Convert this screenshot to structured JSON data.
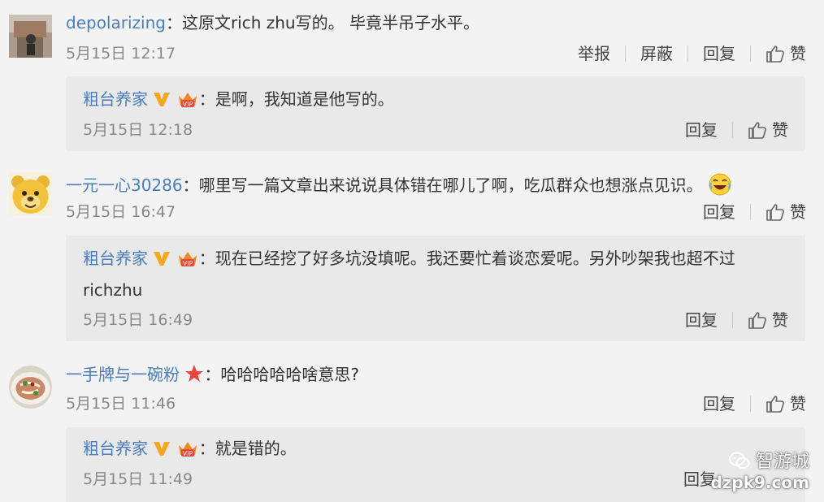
{
  "comments": [
    {
      "user": "depolarizing",
      "text": "：这原文rich zhu写的。 毕竟半吊子水平。",
      "time": "5月15日 12:17",
      "actions": [
        "举报",
        "屏蔽",
        "回复",
        "赞"
      ],
      "reply": {
        "user": "粗台养家",
        "text": "：是啊，我知道是他写的。",
        "time": "5月15日 12:18",
        "actions": [
          "回复",
          "赞"
        ]
      }
    },
    {
      "user": "一元一心30286",
      "text": "：哪里写一篇文章出来说说具体错在哪儿了啊，吃瓜群众也想涨点见识。",
      "time": "5月15日 16:47",
      "actions": [
        "回复",
        "赞"
      ],
      "reply": {
        "user": "粗台养家",
        "text": "：现在已经挖了好多坑没填呢。我还要忙着谈恋爱呢。另外吵架我也超不过",
        "text2": "richzhu",
        "time": "5月15日 16:49",
        "actions": [
          "回复",
          "赞"
        ]
      }
    },
    {
      "user": "一手牌与一碗粉",
      "text": "：哈哈哈哈哈啥意思?",
      "time": "5月15日 11:46",
      "actions": [
        "回复",
        "赞"
      ],
      "reply": {
        "user": "粗台养家",
        "text": "：就是错的。",
        "time": "5月15日 11:49",
        "actions": [
          "回复"
        ]
      }
    }
  ],
  "watermark": {
    "title": "智游城",
    "url": "dzpk9.com"
  },
  "colors": {
    "username": "#4a7dbb",
    "reply_bg": "#e9e9e9",
    "page_bg": "#f3f3f3"
  }
}
